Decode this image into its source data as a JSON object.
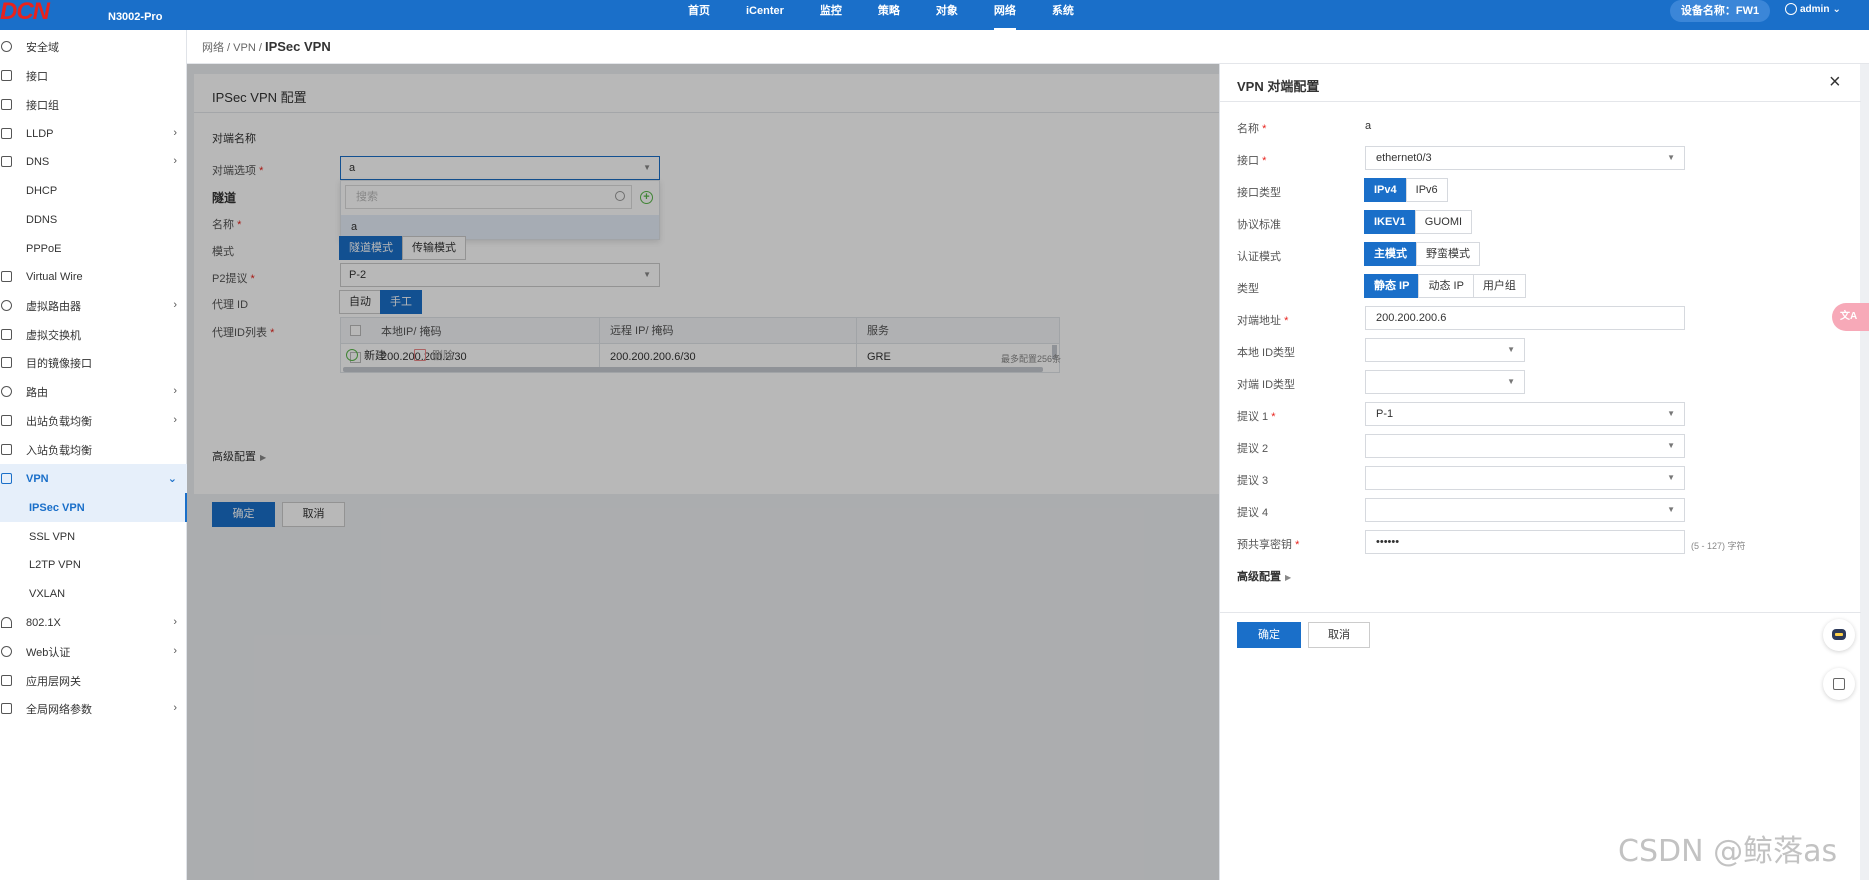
{
  "topbar": {
    "logo": "DCN",
    "model": "N3002-Pro",
    "nav": [
      "首页",
      "iCenter",
      "监控",
      "策略",
      "对象",
      "网络",
      "系统"
    ],
    "active_nav": "网络",
    "device_label": "设备名称：FW1",
    "user": "admin"
  },
  "sidebar": {
    "items": [
      {
        "label": "安全域",
        "icon": "shield-icon",
        "chevron": false
      },
      {
        "label": "接口",
        "icon": "interface-icon",
        "chevron": false
      },
      {
        "label": "接口组",
        "icon": "interface-group-icon",
        "chevron": false
      },
      {
        "label": "LLDP",
        "icon": "lldp-icon",
        "chevron": true
      },
      {
        "label": "DNS",
        "icon": "dns-icon",
        "chevron": true
      },
      {
        "label": "DHCP",
        "icon": "dhcp-icon",
        "chevron": false
      },
      {
        "label": "DDNS",
        "icon": "ddns-icon",
        "chevron": false
      },
      {
        "label": "PPPoE",
        "icon": "pppoe-icon",
        "chevron": false
      },
      {
        "label": "Virtual Wire",
        "icon": "virtual-wire-icon",
        "chevron": false
      },
      {
        "label": "虚拟路由器",
        "icon": "virtual-router-icon",
        "chevron": true
      },
      {
        "label": "虚拟交换机",
        "icon": "virtual-switch-icon",
        "chevron": false
      },
      {
        "label": "目的镜像接口",
        "icon": "mirror-icon",
        "chevron": false
      },
      {
        "label": "路由",
        "icon": "route-icon",
        "chevron": true
      },
      {
        "label": "出站负载均衡",
        "icon": "outbound-lb-icon",
        "chevron": true
      },
      {
        "label": "入站负载均衡",
        "icon": "inbound-lb-icon",
        "chevron": false
      },
      {
        "label": "VPN",
        "icon": "vpn-icon",
        "chevron": true
      },
      {
        "label": "IPSec VPN",
        "sub": true
      },
      {
        "label": "SSL VPN",
        "sub": true
      },
      {
        "label": "L2TP VPN",
        "sub": true
      },
      {
        "label": "VXLAN",
        "sub": true
      },
      {
        "label": "802.1X",
        "icon": "wifi-icon",
        "chevron": true
      },
      {
        "label": "Web认证",
        "icon": "web-auth-icon",
        "chevron": true
      },
      {
        "label": "应用层网关",
        "icon": "app-gateway-icon",
        "chevron": false
      },
      {
        "label": "全局网络参数",
        "icon": "global-params-icon",
        "chevron": true
      }
    ]
  },
  "breadcrumb": {
    "path": "网络 / VPN / ",
    "current": "IPSec VPN"
  },
  "main": {
    "title": "IPSec VPN 配置",
    "peer_name_label": "对端名称",
    "peer_option_label": "对端选项",
    "peer_option_value": "a",
    "dropdown": {
      "search_placeholder": "搜索",
      "option": "a"
    },
    "tunnel_label": "隧道",
    "name_label": "名称",
    "mode_label": "模式",
    "mode_options": [
      "隧道模式",
      "传输模式"
    ],
    "p2_label": "P2提议",
    "p2_value": "P-2",
    "proxy_id_label": "代理 ID",
    "proxy_id_options": [
      "自动",
      "手工"
    ],
    "proxy_list_label": "代理ID列表",
    "table": {
      "headers": [
        "本地IP/ 掩码",
        "远程 IP/ 掩码",
        "服务"
      ],
      "rows": [
        [
          "200.200.200.2/30",
          "200.200.200.6/30",
          "GRE"
        ]
      ]
    },
    "new_label": "新建",
    "delete_label": "删除",
    "max_note": "最多配置256条",
    "advanced_label": "高级配置",
    "ok_label": "确定",
    "cancel_label": "取消"
  },
  "drawer": {
    "title": "VPN 对端配置",
    "name_label": "名称",
    "name_value": "a",
    "interface_label": "接口",
    "interface_value": "ethernet0/3",
    "iftype_label": "接口类型",
    "iftype_options": [
      "IPv4",
      "IPv6"
    ],
    "protocol_label": "协议标准",
    "protocol_options": [
      "IKEV1",
      "GUOMI"
    ],
    "auth_label": "认证模式",
    "auth_options": [
      "主模式",
      "野蛮模式"
    ],
    "type_label": "类型",
    "type_options": [
      "静态 IP",
      "动态 IP",
      "用户组"
    ],
    "peer_addr_label": "对端地址",
    "peer_addr_value": "200.200.200.6",
    "local_id_label": "本地 ID类型",
    "peer_id_label": "对端 ID类型",
    "proposal1_label": "提议 1",
    "proposal1_value": "P-1",
    "proposal2_label": "提议 2",
    "proposal3_label": "提议 3",
    "proposal4_label": "提议 4",
    "psk_label": "预共享密钥",
    "psk_value": "••••••",
    "psk_hint": "(5 - 127) 字符",
    "advanced_label": "高级配置",
    "ok_label": "确定",
    "cancel_label": "取消"
  },
  "floating": {
    "translate": "文A"
  },
  "watermark": "CSDN @鲸落as",
  "colors": {
    "primary": "#1a6fc9",
    "required": "#e8231d",
    "logo": "#e8231d"
  }
}
